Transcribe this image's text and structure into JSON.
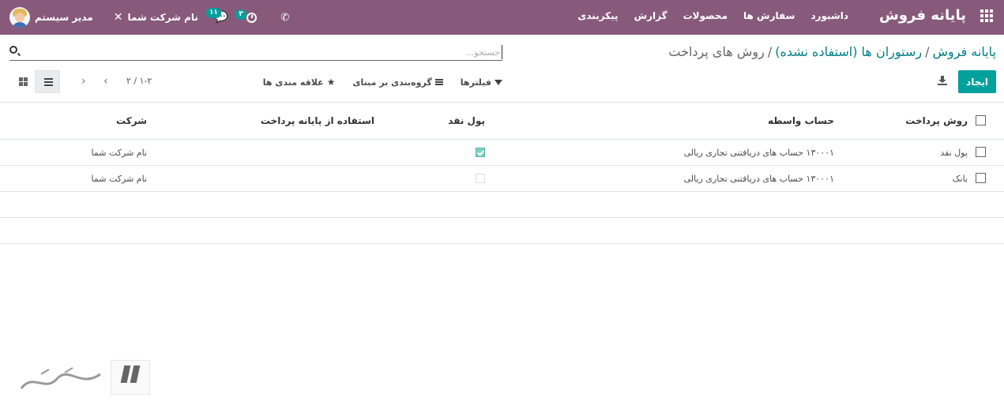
{
  "navbar": {
    "brand": "پایانه فروش",
    "menu": [
      "داشبورد",
      "سفارش ها",
      "محصولات",
      "گزارش",
      "پیکربندی"
    ],
    "user_name": "مدیر سیستم",
    "company_name": "نام شرکت شما",
    "chat_count": "۱۱",
    "activity_count": "۳",
    "color": "#875a7b"
  },
  "breadcrumb": {
    "items": [
      "پایانه فروش",
      "رستوران ها (استفاده نشده)"
    ],
    "separator": "/",
    "current": "روش های پرداخت"
  },
  "search": {
    "placeholder": "جستجو..."
  },
  "toolbar": {
    "create_label": "ایجاد",
    "filters_label": "فیلترها",
    "groupby_label": "گروه‌بندی بر مبنای",
    "favorites_label": "علاقه مندی ها",
    "pager": "۱-۲ / ۲",
    "accent_color": "#00a09d"
  },
  "table": {
    "columns": [
      "روش پرداخت",
      "حساب واسطه",
      "پول نقد",
      "استفاده از پایانه پرداخت",
      "شرکت"
    ],
    "rows": [
      {
        "name": "پول نقد",
        "account": "۱۳۰۰۰۱ حساب های دریافتنی تجاری ریالی",
        "is_cash": true,
        "terminal": "",
        "company": "نام شرکت شما"
      },
      {
        "name": "بانک",
        "account": "۱۳۰۰۰۱ حساب های دریافتنی تجاری ریالی",
        "is_cash": false,
        "terminal": "",
        "company": "نام شرکت شما"
      }
    ]
  },
  "watermark": {
    "icon": "watermark-logo-icon"
  }
}
